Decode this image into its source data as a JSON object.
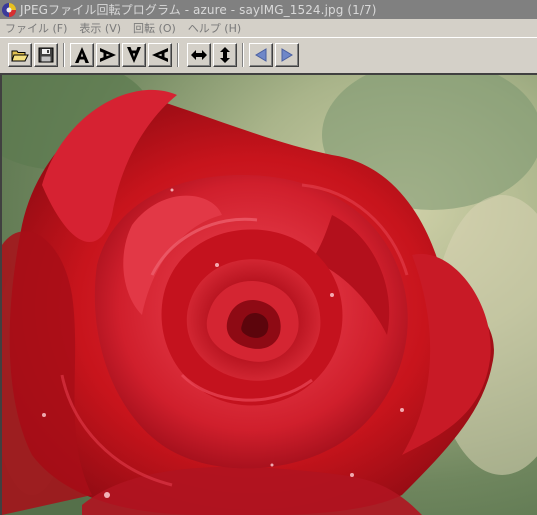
{
  "window": {
    "title": "JPEGファイル回転プログラム - azure - sayIMG_1524.jpg (1/7)"
  },
  "menu": {
    "items": [
      {
        "label": "ファイル (F)",
        "name": "menu-file"
      },
      {
        "label": "表示 (V)",
        "name": "menu-view"
      },
      {
        "label": "回転 (O)",
        "name": "menu-rotate"
      },
      {
        "label": "ヘルプ (H)",
        "name": "menu-help"
      }
    ]
  },
  "toolbar": {
    "buttons": [
      {
        "name": "open-folder-button",
        "icon": "open-folder-icon"
      },
      {
        "name": "save-button",
        "icon": "floppy-disk-icon"
      },
      {
        "name": "rotate-0-button",
        "icon": "letter-a-upright-icon"
      },
      {
        "name": "rotate-right-button",
        "icon": "letter-a-rotate-right-icon"
      },
      {
        "name": "rotate-180-button",
        "icon": "letter-a-upside-down-icon"
      },
      {
        "name": "rotate-left-button",
        "icon": "letter-a-rotate-left-icon"
      },
      {
        "name": "flip-horizontal-button",
        "icon": "horizontal-arrows-icon"
      },
      {
        "name": "flip-vertical-button",
        "icon": "vertical-arrows-icon"
      },
      {
        "name": "previous-image-button",
        "icon": "triangle-left-icon"
      },
      {
        "name": "next-image-button",
        "icon": "triangle-right-icon"
      }
    ]
  },
  "image": {
    "subject": "red rose"
  },
  "colors": {
    "titlebar": "#808080",
    "title_text": "#d9d9d9",
    "chrome": "#d4d0c8",
    "menu_text_disabled": "#7a7a7a",
    "nav_arrow": "#6f87c8",
    "rose_red": "#c8141c"
  }
}
